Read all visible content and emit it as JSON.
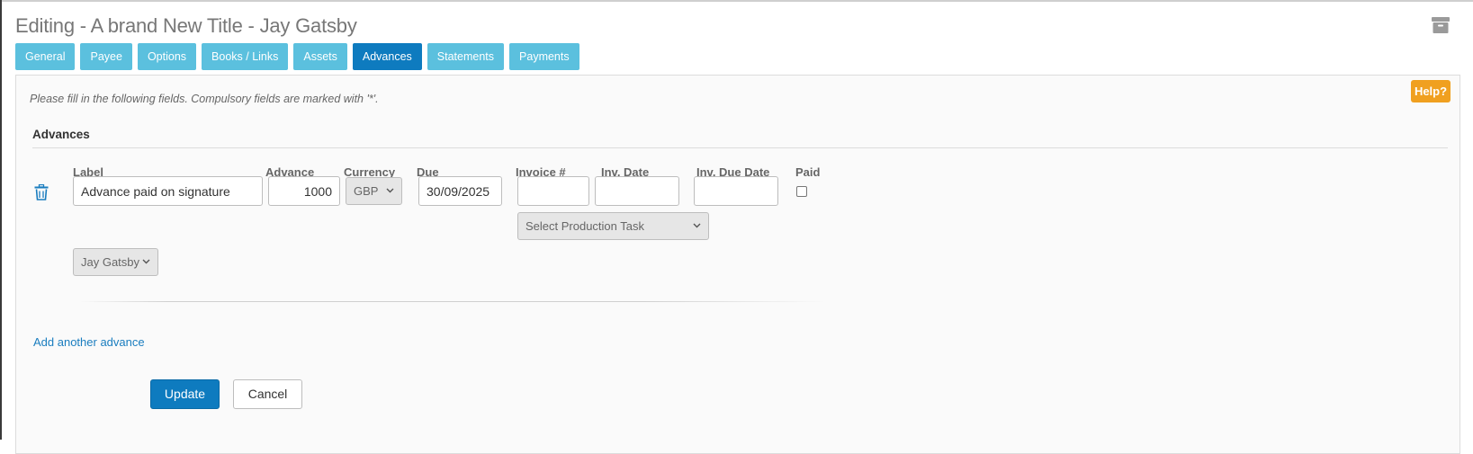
{
  "page": {
    "title": "Editing - A brand New Title - Jay Gatsby"
  },
  "icons": {
    "archive": "archive-icon",
    "trash": "trash-icon",
    "dropdown": "chevron-down-icon"
  },
  "colors": {
    "tab": "#5bc0de",
    "tab_active": "#0e7bbf",
    "help": "#f0a020",
    "primary": "#0e7bbf",
    "link": "#1a7dbf"
  },
  "tabs": [
    {
      "label": "General",
      "active": false
    },
    {
      "label": "Payee",
      "active": false
    },
    {
      "label": "Options",
      "active": false
    },
    {
      "label": "Books / Links",
      "active": false
    },
    {
      "label": "Assets",
      "active": false
    },
    {
      "label": "Advances",
      "active": true
    },
    {
      "label": "Statements",
      "active": false
    },
    {
      "label": "Payments",
      "active": false
    }
  ],
  "form": {
    "intro": "Please fill in the following fields. Compulsory fields are marked with '*'.",
    "help_label": "Help?",
    "section_title": "Advances",
    "columns": {
      "label": "Label",
      "advance": "Advance",
      "currency": "Currency",
      "due": "Due",
      "invoice": "Invoice #",
      "inv_date": "Inv. Date",
      "inv_due_date": "Inv. Due Date",
      "paid": "Paid"
    },
    "row": {
      "label": "Advance paid on signature",
      "advance": "1000",
      "currency": "GBP",
      "due": "30/09/2025",
      "invoice": "",
      "inv_date": "",
      "inv_due_date": "",
      "paid": false,
      "production_task": "Select Production Task",
      "payee": "Jay Gatsby"
    },
    "add_another": "Add another advance",
    "update_label": "Update",
    "cancel_label": "Cancel"
  }
}
